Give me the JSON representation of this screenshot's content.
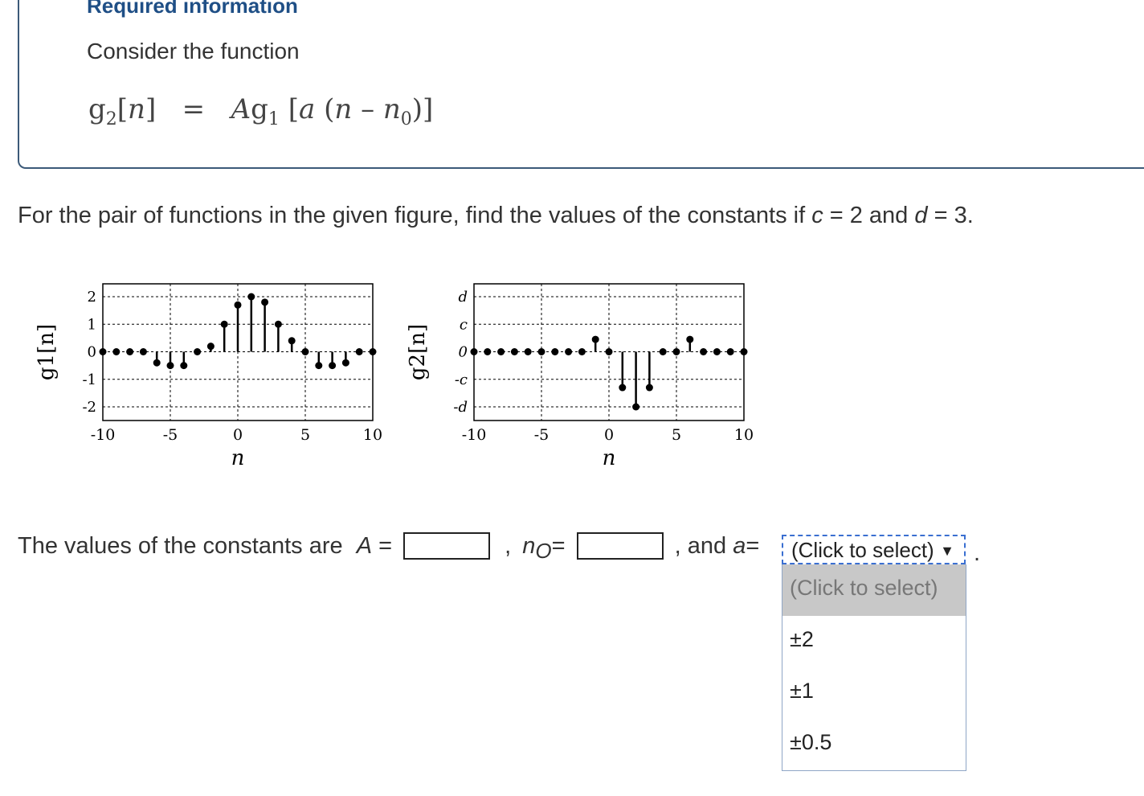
{
  "required": {
    "title": "Required information",
    "intro": "Consider the function"
  },
  "formula": {
    "lhs_func": "g",
    "lhs_sub": "2",
    "lhs_arg": "n",
    "equals": "=",
    "rhs_A": "A",
    "rhs_func": "g",
    "rhs_sub": "1",
    "rhs_a": "a",
    "rhs_n": "n",
    "rhs_minus": "–",
    "rhs_n0": "n",
    "rhs_n0_sub": "0"
  },
  "question": {
    "text_before": "For the pair of functions in the given figure, find the values of the constants if ",
    "c_var": "c",
    "c_eq": " = 2 and ",
    "d_var": "d",
    "d_eq": " = 3."
  },
  "figure": {
    "plot1": {
      "ylabel": "g1[n]",
      "xlabel": "n",
      "yticks": [
        "2",
        "1",
        "0",
        "-1",
        "-2"
      ],
      "xticks": [
        "-10",
        "-5",
        "0",
        "5",
        "10"
      ],
      "x": [
        -10,
        -9,
        -8,
        -7,
        -6,
        -5,
        -4,
        -3,
        -2,
        -1,
        0,
        1,
        2,
        3,
        4,
        5,
        6,
        7,
        8,
        9,
        10
      ],
      "y": [
        0,
        0,
        0,
        0,
        -0.4,
        -0.5,
        -0.5,
        0,
        0.2,
        1,
        1.7,
        2,
        1.8,
        1,
        0.4,
        0,
        -0.5,
        -0.5,
        -0.4,
        0,
        0
      ]
    },
    "plot2": {
      "ylabel": "g2[n]",
      "xlabel": "n",
      "yticks": [
        "d",
        "c",
        "0",
        "-c",
        "-d"
      ],
      "xticks": [
        "-10",
        "-5",
        "0",
        "5",
        "10"
      ],
      "x": [
        -10,
        -9,
        -8,
        -7,
        -6,
        -5,
        -4,
        -3,
        -2,
        -1,
        0,
        1,
        2,
        3,
        4,
        5,
        6,
        7,
        8,
        9,
        10
      ],
      "y": [
        0,
        0,
        0,
        0,
        0,
        0,
        0,
        0,
        0,
        0.45,
        0,
        -1.3,
        -2,
        -1.3,
        0,
        0,
        0.45,
        0,
        0,
        0,
        0
      ]
    }
  },
  "answer": {
    "prefix": "The values of the constants are ",
    "A_var": "A",
    "eq": " =",
    "comma": ",",
    "n_var": "n",
    "n_sub": "O",
    "and": ", and ",
    "a_var": "a",
    "period": "."
  },
  "select": {
    "current": "(Click to select)",
    "arrow": "▼",
    "options": [
      "(Click to select)",
      "±2",
      "±1",
      "±0.5"
    ]
  }
}
